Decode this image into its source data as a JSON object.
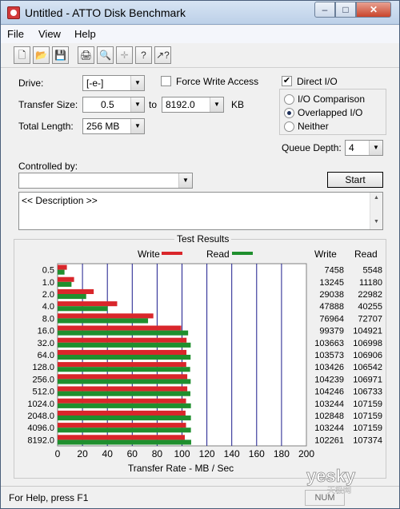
{
  "window": {
    "title": "Untitled - ATTO Disk Benchmark",
    "min_glyph": "–",
    "max_glyph": "□",
    "close_glyph": "✕"
  },
  "menu": {
    "file": "File",
    "view": "View",
    "help": "Help"
  },
  "toolbar": {
    "buttons": [
      {
        "name": "new-document-icon",
        "glyph": "🗋"
      },
      {
        "name": "open-folder-icon",
        "glyph": "📂"
      },
      {
        "name": "save-icon",
        "glyph": "💾"
      },
      {
        "name": "print-icon",
        "glyph": "🖨"
      },
      {
        "name": "print-preview-icon",
        "glyph": "🔍"
      },
      {
        "name": "move-icon",
        "glyph": "✛"
      },
      {
        "name": "help-icon",
        "glyph": "?"
      },
      {
        "name": "context-help-icon",
        "glyph": "↗?"
      }
    ]
  },
  "form": {
    "drive_label": "Drive:",
    "drive_value": "[-e-]",
    "force_write_label": "Force Write Access",
    "force_write_checked": false,
    "direct_io_label": "Direct I/O",
    "direct_io_checked": true,
    "transfer_size_label": "Transfer Size:",
    "transfer_from": "0.5",
    "to_label": "to",
    "transfer_to": "8192.0",
    "kb_label": "KB",
    "total_length_label": "Total Length:",
    "total_length_value": "256 MB",
    "io_comparison_label": "I/O Comparison",
    "overlapped_io_label": "Overlapped I/O",
    "neither_label": "Neither",
    "selected_io_mode": "Overlapped I/O",
    "queue_depth_label": "Queue Depth:",
    "queue_depth_value": "4",
    "controlled_by_label": "Controlled by:",
    "controlled_by_value": "",
    "start_label": "Start",
    "description": "<< Description >>"
  },
  "results": {
    "title": "Test Results",
    "legend_write": "Write",
    "legend_read": "Read",
    "col_write": "Write",
    "col_read": "Read",
    "write_color": "#d9262b",
    "read_color": "#1f8f2e"
  },
  "chart_data": {
    "type": "bar",
    "orientation": "horizontal",
    "categories": [
      "0.5",
      "1.0",
      "2.0",
      "4.0",
      "8.0",
      "16.0",
      "32.0",
      "64.0",
      "128.0",
      "256.0",
      "512.0",
      "1024.0",
      "2048.0",
      "4096.0",
      "8192.0"
    ],
    "series": [
      {
        "name": "Write",
        "values": [
          7458,
          13245,
          29038,
          47888,
          76964,
          99379,
          103663,
          103573,
          103426,
          104239,
          104246,
          103244,
          102848,
          103244,
          102261
        ]
      },
      {
        "name": "Read",
        "values": [
          5548,
          11180,
          22982,
          40255,
          72707,
          104921,
          106998,
          106906,
          106542,
          106971,
          106733,
          107159,
          107159,
          107159,
          107374
        ]
      }
    ],
    "xlabel": "Transfer Rate - MB / Sec",
    "xlim": [
      0,
      200
    ],
    "xticks": [
      "0",
      "20",
      "40",
      "60",
      "80",
      "100",
      "120",
      "140",
      "160",
      "180",
      "200"
    ],
    "unit_divisor": 1000,
    "grid": true,
    "legend": "top"
  },
  "status": {
    "text": "For Help, press F1",
    "cell": "NUM"
  },
  "watermark": {
    "text": "yesky",
    "sub": "天极网"
  }
}
